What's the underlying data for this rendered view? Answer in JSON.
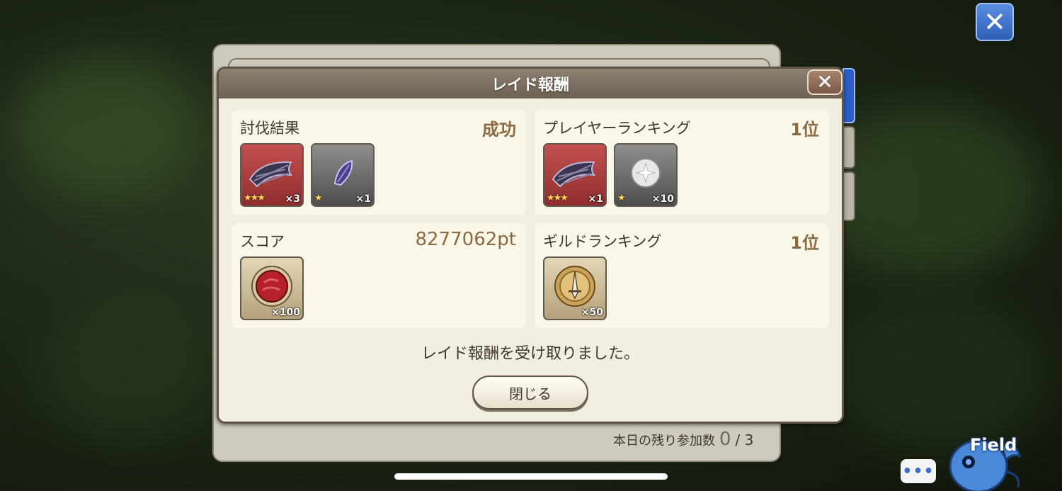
{
  "top_close_label": "✕",
  "back_panel": {
    "remaining_label": "本日の残り参加数",
    "remaining_current": "0",
    "remaining_max": "/ 3"
  },
  "dialog": {
    "title": "レイド報酬",
    "close_label": "✕",
    "cards": {
      "battle_result": {
        "label": "討伐結果",
        "value": "成功",
        "items": [
          {
            "icon": "dark-feather-bundle-icon",
            "stars": "★★★",
            "qty": "×3"
          },
          {
            "icon": "purple-feather-icon",
            "stars": "★",
            "qty": "×1"
          }
        ]
      },
      "player_ranking": {
        "label": "プレイヤーランキング",
        "value": "1位",
        "items": [
          {
            "icon": "dark-feather-bundle-icon",
            "stars": "★★★",
            "qty": "×1"
          },
          {
            "icon": "silver-orb-icon",
            "stars": "★",
            "qty": "×10"
          }
        ]
      },
      "score": {
        "label": "スコア",
        "value": "8277062pt",
        "items": [
          {
            "icon": "red-meat-icon",
            "qty": "×100"
          }
        ]
      },
      "guild_ranking": {
        "label": "ギルドランキング",
        "value": "1位",
        "items": [
          {
            "icon": "sword-medal-icon",
            "qty": "×50"
          }
        ]
      }
    },
    "message": "レイド報酬を受け取りました。",
    "close_button_label": "閉じる"
  },
  "hud": {
    "chat_label": "•••",
    "field_label": "Field"
  }
}
